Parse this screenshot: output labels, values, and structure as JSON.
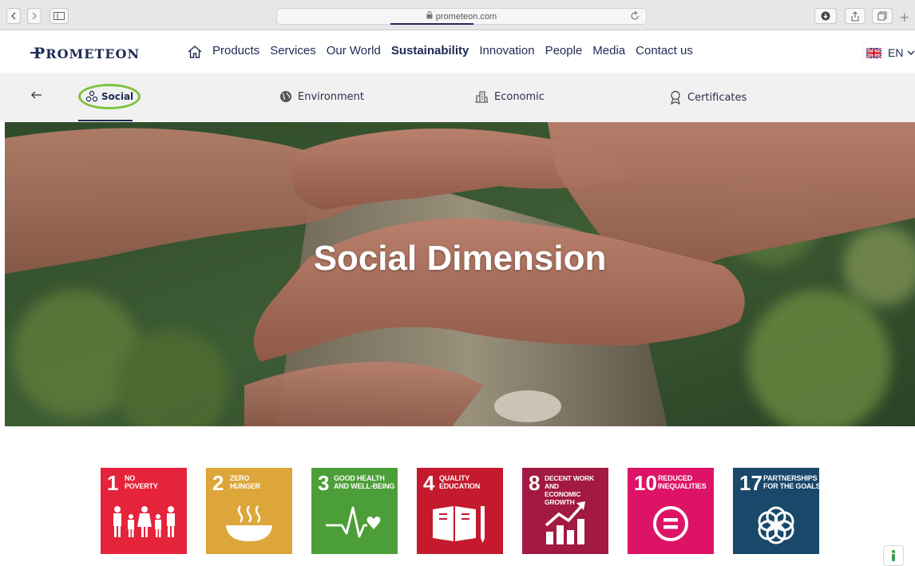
{
  "browser": {
    "url": "prometeon.com"
  },
  "nav": {
    "logo": "PROMETEON",
    "logo_first": "P",
    "logo_rest": "ROMETEON",
    "items": [
      "Products",
      "Services",
      "Our World",
      "Sustainability",
      "Innovation",
      "People",
      "Media",
      "Contact us"
    ],
    "active_item": "Sustainability",
    "language": "EN"
  },
  "subnav": {
    "items": [
      "Social",
      "Environment",
      "Economic",
      "Certificates"
    ],
    "active": "Social"
  },
  "hero": {
    "title": "Social Dimension"
  },
  "sdgs": [
    {
      "number": "1",
      "label": "NO\nPOVERTY",
      "color": "#e5243b",
      "icon": "family-icon"
    },
    {
      "number": "2",
      "label": "ZERO\nHUNGER",
      "color": "#dda63a",
      "icon": "bowl-icon"
    },
    {
      "number": "3",
      "label": "GOOD HEALTH\nAND WELL-BEING",
      "color": "#4c9f38",
      "icon": "heartbeat-icon"
    },
    {
      "number": "4",
      "label": "QUALITY\nEDUCATION",
      "color": "#c5192d",
      "icon": "book-icon"
    },
    {
      "number": "8",
      "label": "DECENT WORK AND\nECONOMIC GROWTH",
      "color": "#a21942",
      "icon": "growth-chart-icon"
    },
    {
      "number": "10",
      "label": "REDUCED\nINEQUALITIES",
      "color": "#dd1367",
      "icon": "equality-icon"
    },
    {
      "number": "17",
      "label": "PARTNERSHIPS\nFOR THE GOALS",
      "color": "#19486a",
      "icon": "rings-icon"
    }
  ],
  "colors": {
    "brand_navy": "#1e2a55",
    "social_highlight": "#7fc241"
  }
}
